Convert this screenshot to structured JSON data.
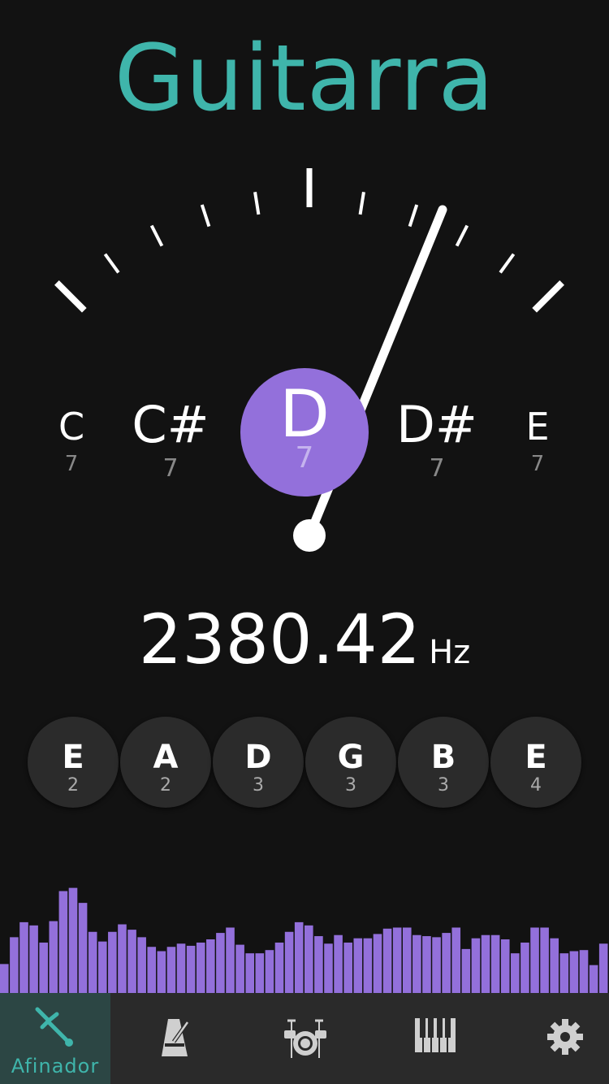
{
  "app": {
    "title": "Guitarra",
    "accent": "#3fb5ab",
    "note_color": "#9370db"
  },
  "tuner": {
    "notes": [
      {
        "name": "C",
        "octave": "7"
      },
      {
        "name": "C#",
        "octave": "7"
      },
      {
        "name": "D",
        "octave": "7"
      },
      {
        "name": "D#",
        "octave": "7"
      },
      {
        "name": "E",
        "octave": "7"
      }
    ],
    "active_index": 2,
    "frequency": "2380.42",
    "unit": "Hz"
  },
  "strings": [
    {
      "name": "E",
      "octave": "2"
    },
    {
      "name": "A",
      "octave": "2"
    },
    {
      "name": "D",
      "octave": "3"
    },
    {
      "name": "G",
      "octave": "3"
    },
    {
      "name": "B",
      "octave": "3"
    },
    {
      "name": "E",
      "octave": "4"
    }
  ],
  "spectrum_levels": [
    0.27,
    0.52,
    0.66,
    0.63,
    0.47,
    0.67,
    0.95,
    0.98,
    0.84,
    0.57,
    0.48,
    0.57,
    0.64,
    0.59,
    0.52,
    0.43,
    0.39,
    0.43,
    0.46,
    0.44,
    0.47,
    0.5,
    0.56,
    0.61,
    0.45,
    0.37,
    0.37,
    0.4,
    0.47,
    0.57,
    0.66,
    0.63,
    0.53,
    0.46,
    0.54,
    0.47,
    0.51,
    0.51,
    0.55,
    0.6,
    0.61,
    0.61,
    0.54,
    0.53,
    0.52,
    0.56,
    0.61,
    0.41,
    0.51,
    0.54,
    0.54,
    0.5,
    0.37,
    0.47,
    0.61,
    0.61,
    0.51,
    0.37,
    0.39,
    0.4,
    0.26,
    0.46
  ],
  "tabs": [
    {
      "label": "Afinador",
      "icon": "tuning-fork-icon",
      "active": true
    },
    {
      "label": "",
      "icon": "metronome-icon",
      "active": false
    },
    {
      "label": "",
      "icon": "drum-kit-icon",
      "active": false
    },
    {
      "label": "",
      "icon": "piano-icon",
      "active": false
    },
    {
      "label": "",
      "icon": "gear-icon",
      "active": false
    }
  ]
}
